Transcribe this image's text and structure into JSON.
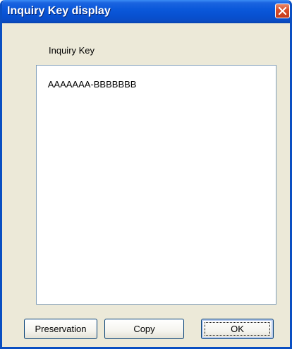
{
  "window": {
    "title": "Inquiry Key display"
  },
  "form": {
    "label": "Inquiry Key",
    "key_value": "AAAAAAA-BBBBBBB"
  },
  "buttons": {
    "preservation_label": "Preservation",
    "copy_label": "Copy",
    "ok_label": "OK"
  },
  "icons": {
    "close": "close-icon"
  },
  "colors": {
    "titlebar": "#0a58da",
    "close_button": "#d9502b",
    "dialog_background": "#ece9d8"
  }
}
